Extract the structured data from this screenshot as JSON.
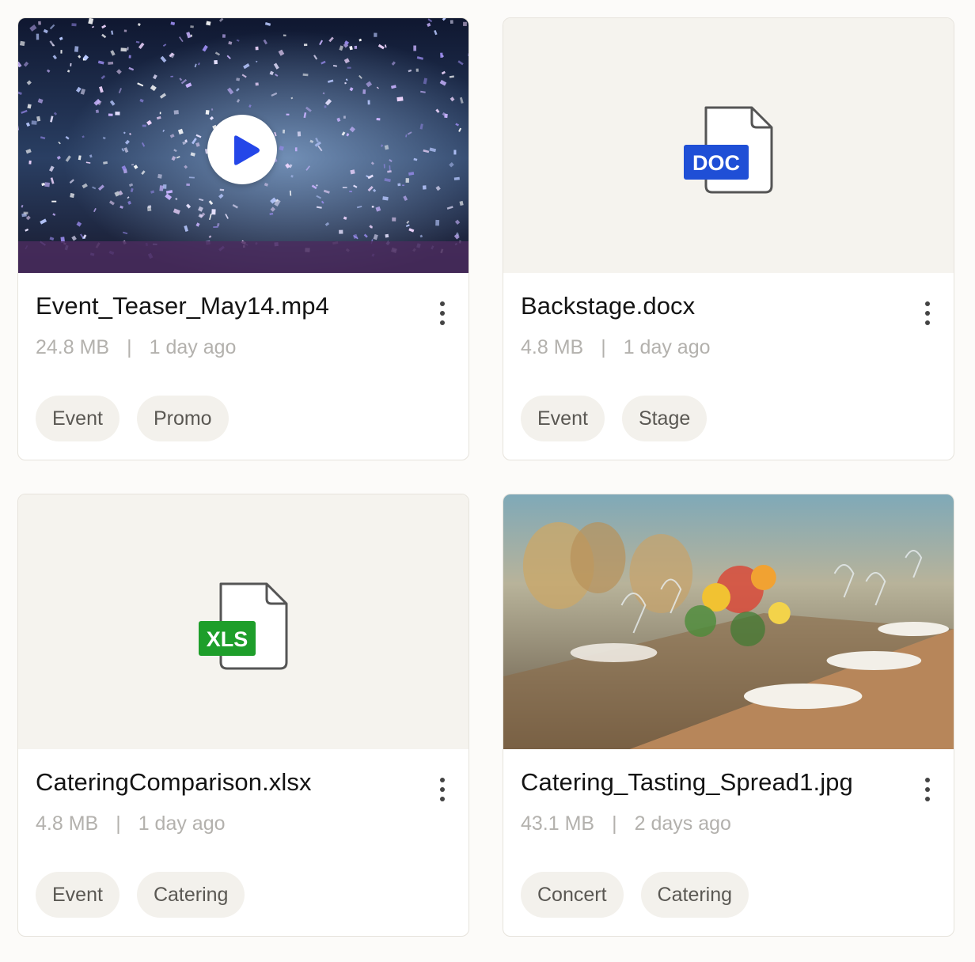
{
  "files": [
    {
      "name": "Event_Teaser_May14.mp4",
      "size": "24.8 MB",
      "separator": "|",
      "modified": "1 day ago",
      "tags": [
        "Event",
        "Promo"
      ],
      "preview": "video-thumbnail",
      "icon": "play-icon"
    },
    {
      "name": "Backstage.docx",
      "size": "4.8 MB",
      "separator": "|",
      "modified": "1 day ago",
      "tags": [
        "Event",
        "Stage"
      ],
      "preview": "file-type-icon",
      "badge_label": "DOC",
      "badge_color": "#1f4fd6",
      "icon": "doc-file-icon"
    },
    {
      "name": "CateringComparison.xlsx",
      "size": "4.8 MB",
      "separator": "|",
      "modified": "1 day ago",
      "tags": [
        "Event",
        "Catering"
      ],
      "preview": "file-type-icon",
      "badge_label": "XLS",
      "badge_color": "#1e9e2a",
      "icon": "xls-file-icon"
    },
    {
      "name": "Catering_Tasting_Spread1.jpg",
      "size": "43.1 MB",
      "separator": "|",
      "modified": "2 days ago",
      "tags": [
        "Concert",
        "Catering"
      ],
      "preview": "image-thumbnail"
    }
  ],
  "colors": {
    "play_accent": "#2446e8",
    "tag_background": "#f3f1ec",
    "placeholder_background": "#f5f3ee"
  }
}
